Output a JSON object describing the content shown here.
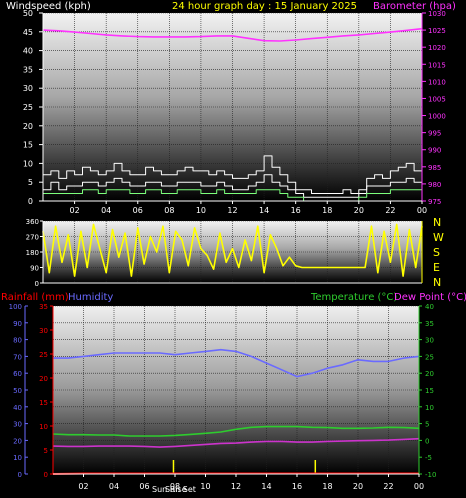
{
  "colors": {
    "background": "#000000",
    "wind_speed": "#ffffff",
    "wind_gust": "#ffffff",
    "wind_avg": "#7cff7c",
    "barometer": "#ff33ff",
    "wind_direction": "#ffff00",
    "rainfall": "#ff0000",
    "humidity": "#6a6aff",
    "temperature": "#2ecc2e",
    "dew_point": "#cc33cc",
    "header_yellow": "#ffff00",
    "sun_marker": "#ffff00"
  },
  "header": {
    "left": "Windspeed (kph)",
    "center": "24 hour graph day : 15 January 2025",
    "right": "Barometer (hpa)"
  },
  "dir_labels": [
    "N",
    "W",
    "S",
    "E",
    "N"
  ],
  "bottom_header": {
    "rain": "Rainfall (mm)",
    "humidity": "Humidity",
    "temperature": "Temperature (°C)",
    "dewpoint": "Dew Point (°C)"
  },
  "sun_labels": {
    "rise": "Sun Rise",
    "set": "Sun Set"
  },
  "chart_data": [
    {
      "type": "line",
      "title": "24 hour graph day : 15 January 2025",
      "xlabel": "",
      "x_ticks": [
        "02",
        "04",
        "06",
        "08",
        "10",
        "12",
        "14",
        "16",
        "18",
        "20",
        "22",
        "00"
      ],
      "xlim": [
        0,
        24
      ],
      "left_axis": {
        "label": "Windspeed (kph)",
        "ylim": [
          0,
          50
        ],
        "ticks": [
          0,
          5,
          10,
          15,
          20,
          25,
          30,
          35,
          40,
          45,
          50
        ]
      },
      "right_axis": {
        "label": "Barometer (hpa)",
        "ylim": [
          975,
          1030
        ],
        "ticks": [
          975,
          980,
          985,
          990,
          995,
          1000,
          1005,
          1010,
          1015,
          1020,
          1025,
          1030
        ]
      },
      "grid": true,
      "series": [
        {
          "name": "Barometer",
          "axis": "right",
          "x": [
            0,
            1,
            2,
            3,
            4,
            5,
            6,
            7,
            8,
            9,
            10,
            11,
            12,
            13,
            14,
            15,
            16,
            17,
            18,
            19,
            20,
            21,
            22,
            23,
            24
          ],
          "values": [
            1025,
            1024.8,
            1024.4,
            1024,
            1023.6,
            1023.3,
            1023.1,
            1023,
            1023,
            1023,
            1023.1,
            1023.3,
            1023.3,
            1022.6,
            1021.9,
            1021.8,
            1022.1,
            1022.5,
            1022.9,
            1023.3,
            1023.6,
            1024,
            1024.4,
            1024.9,
            1025.4
          ]
        },
        {
          "name": "Wind gust",
          "axis": "left",
          "x": [
            0,
            0.5,
            1,
            1.5,
            2,
            2.5,
            3,
            3.5,
            4,
            4.5,
            5,
            5.5,
            6,
            6.5,
            7,
            7.5,
            8,
            8.5,
            9,
            9.5,
            10,
            10.5,
            11,
            11.5,
            12,
            12.5,
            13,
            13.5,
            14,
            14.5,
            15,
            15.5,
            16,
            16.5,
            17,
            17.5,
            18,
            18.5,
            19,
            19.5,
            20,
            20.5,
            21,
            21.5,
            22,
            22.5,
            23,
            23.5,
            24
          ],
          "values": [
            7,
            8,
            6,
            8,
            7,
            9,
            8,
            7,
            8,
            10,
            8,
            7,
            7,
            9,
            8,
            7,
            7,
            8,
            9,
            8,
            8,
            7,
            8,
            7,
            6,
            6,
            7,
            8,
            12,
            9,
            7,
            5,
            3,
            3,
            2,
            2,
            2,
            2,
            3,
            2,
            3,
            6,
            7,
            6,
            8,
            9,
            10,
            8,
            9
          ]
        },
        {
          "name": "Wind speed",
          "axis": "left",
          "x": [
            0,
            0.5,
            1,
            1.5,
            2,
            2.5,
            3,
            3.5,
            4,
            4.5,
            5,
            5.5,
            6,
            6.5,
            7,
            7.5,
            8,
            8.5,
            9,
            9.5,
            10,
            10.5,
            11,
            11.5,
            12,
            12.5,
            13,
            13.5,
            14,
            14.5,
            15,
            15.5,
            16,
            16.5,
            17,
            17.5,
            18,
            18.5,
            19,
            19.5,
            20,
            20.5,
            21,
            21.5,
            22,
            22.5,
            23,
            23.5,
            24
          ],
          "values": [
            3,
            5,
            3,
            4,
            4,
            5,
            5,
            4,
            5,
            6,
            5,
            4,
            4,
            5,
            5,
            4,
            4,
            5,
            5,
            5,
            4,
            4,
            5,
            4,
            3,
            3,
            4,
            5,
            7,
            5,
            4,
            3,
            2,
            1,
            1,
            1,
            1,
            1,
            1,
            1,
            2,
            4,
            4,
            4,
            5,
            5,
            6,
            5,
            5
          ]
        },
        {
          "name": "Wind average",
          "axis": "left",
          "x": [
            0,
            0.5,
            1,
            1.5,
            2,
            2.5,
            3,
            3.5,
            4,
            4.5,
            5,
            5.5,
            6,
            6.5,
            7,
            7.5,
            8,
            8.5,
            9,
            9.5,
            10,
            10.5,
            11,
            11.5,
            12,
            12.5,
            13,
            13.5,
            14,
            14.5,
            15,
            15.5,
            16,
            16.5,
            17,
            17.5,
            18,
            18.5,
            19,
            19.5,
            20,
            20.5,
            21,
            21.5,
            22,
            22.5,
            23,
            23.5,
            24
          ],
          "values": [
            2,
            2,
            2,
            2,
            2,
            3,
            3,
            2,
            3,
            3,
            3,
            2,
            2,
            3,
            3,
            2,
            2,
            3,
            3,
            3,
            2,
            2,
            3,
            2,
            2,
            2,
            2,
            3,
            3,
            3,
            2,
            1,
            1,
            0,
            0,
            0,
            0,
            0,
            0,
            0,
            1,
            2,
            2,
            2,
            3,
            3,
            3,
            3,
            3
          ]
        }
      ]
    },
    {
      "type": "line",
      "xlim": [
        0,
        24
      ],
      "left_axis": {
        "ylim": [
          0,
          360
        ],
        "ticks": [
          0,
          90,
          180,
          270,
          360
        ]
      },
      "right_axis": {
        "ticks": [
          "N",
          "W",
          "S",
          "E",
          "N"
        ]
      },
      "grid": true,
      "series": [
        {
          "name": "Wind direction",
          "x": [
            0,
            0.4,
            0.8,
            1.2,
            1.6,
            2,
            2.4,
            2.8,
            3.2,
            3.6,
            4,
            4.4,
            4.8,
            5.2,
            5.6,
            6,
            6.4,
            6.8,
            7.2,
            7.6,
            8,
            8.4,
            8.8,
            9.2,
            9.6,
            10,
            10.4,
            10.8,
            11.2,
            11.6,
            12,
            12.4,
            12.8,
            13.2,
            13.6,
            14,
            14.4,
            14.8,
            15.2,
            15.6,
            16,
            16.4,
            16.8,
            17.2,
            17.6,
            18,
            18.4,
            18.8,
            19.2,
            19.6,
            20,
            20.4,
            20.8,
            21.2,
            21.6,
            22,
            22.4,
            22.8,
            23.2,
            23.6,
            24
          ],
          "values": [
            300,
            60,
            330,
            120,
            280,
            40,
            300,
            90,
            340,
            200,
            60,
            310,
            150,
            290,
            40,
            320,
            110,
            270,
            180,
            330,
            60,
            300,
            250,
            100,
            320,
            200,
            160,
            80,
            290,
            120,
            200,
            90,
            250,
            130,
            330,
            60,
            280,
            200,
            100,
            150,
            100,
            90,
            90,
            90,
            90,
            90,
            90,
            90,
            90,
            90,
            90,
            90,
            330,
            60,
            300,
            120,
            340,
            40,
            310,
            90,
            330
          ]
        }
      ]
    },
    {
      "type": "line",
      "title": "",
      "x_ticks": [
        "02",
        "04",
        "06",
        "08",
        "10",
        "12",
        "14",
        "16",
        "18",
        "20",
        "22",
        "00"
      ],
      "xlim": [
        0,
        24
      ],
      "left_axis_1": {
        "label": "Rainfall (mm)",
        "ylim": [
          0,
          35
        ],
        "ticks": [
          0,
          5,
          10,
          15,
          20,
          25,
          30,
          35
        ]
      },
      "left_axis_2": {
        "label": "Humidity",
        "ylim": [
          0,
          100
        ],
        "ticks": [
          0,
          10,
          20,
          30,
          40,
          50,
          60,
          70,
          80,
          90,
          100
        ]
      },
      "right_axis": {
        "label": "Temperature (°C) / Dew Point (°C)",
        "ylim": [
          -10,
          40
        ],
        "ticks": [
          -10,
          -5,
          0,
          5,
          10,
          15,
          20,
          25,
          30,
          35,
          40
        ]
      },
      "grid": true,
      "markers": [
        {
          "label": "Sun Rise",
          "x": 7.9
        },
        {
          "label": "Sun Set",
          "x": 17.2
        }
      ],
      "series": [
        {
          "name": "Humidity",
          "axis": "humidity",
          "x": [
            0,
            1,
            2,
            3,
            4,
            5,
            6,
            7,
            8,
            9,
            10,
            11,
            12,
            13,
            14,
            15,
            16,
            17,
            18,
            19,
            20,
            21,
            22,
            23,
            24
          ],
          "values": [
            69,
            69,
            70,
            71,
            72,
            72,
            72,
            72,
            71,
            72,
            73,
            74,
            73,
            70,
            66,
            62,
            58,
            60,
            63,
            65,
            68,
            67,
            67,
            69,
            70
          ]
        },
        {
          "name": "Temperature",
          "axis": "temp",
          "x": [
            0,
            1,
            2,
            3,
            4,
            5,
            6,
            7,
            8,
            9,
            10,
            11,
            12,
            13,
            14,
            15,
            16,
            17,
            18,
            19,
            20,
            21,
            22,
            23,
            24
          ],
          "values": [
            1.9,
            1.7,
            1.7,
            1.6,
            1.6,
            1.3,
            1.3,
            1.3,
            1.5,
            1.8,
            2.1,
            2.5,
            3.3,
            3.9,
            4.1,
            4.1,
            4.1,
            3.9,
            3.8,
            3.6,
            3.6,
            3.7,
            3.9,
            3.8,
            3.6
          ]
        },
        {
          "name": "Dew Point",
          "axis": "temp",
          "x": [
            0,
            1,
            2,
            3,
            4,
            5,
            6,
            7,
            8,
            9,
            10,
            11,
            12,
            13,
            14,
            15,
            16,
            17,
            18,
            19,
            20,
            21,
            22,
            23,
            24
          ],
          "values": [
            -1.7,
            -1.8,
            -1.8,
            -1.7,
            -1.7,
            -1.7,
            -1.8,
            -2,
            -1.8,
            -1.5,
            -1.2,
            -0.9,
            -0.8,
            -0.5,
            -0.3,
            -0.3,
            -0.5,
            -0.5,
            -0.3,
            -0.2,
            -0.1,
            0,
            0.1,
            0.3,
            0.5
          ]
        },
        {
          "name": "Rainfall",
          "axis": "rain",
          "x": [
            0,
            2,
            4,
            6,
            8,
            10,
            12,
            14,
            16,
            18,
            20,
            22,
            24
          ],
          "values": [
            0,
            0.1,
            0.1,
            0.1,
            0.1,
            0.1,
            0.1,
            0.1,
            0.1,
            0.1,
            0.1,
            0.1,
            0.1
          ]
        }
      ]
    }
  ]
}
